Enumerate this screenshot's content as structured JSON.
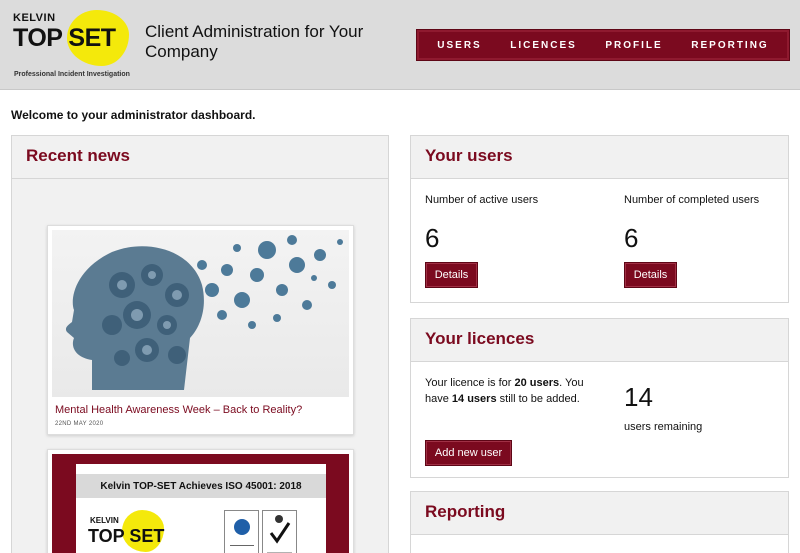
{
  "header": {
    "logo": {
      "kelvin": "KELVIN",
      "wordmark": "TOP SET",
      "tagline": "Professional Incident Investigation"
    },
    "app_title": "Client Administration for Your Company",
    "nav": [
      {
        "label": "USERS"
      },
      {
        "label": "LICENCES"
      },
      {
        "label": "PROFILE"
      },
      {
        "label": "REPORTING"
      }
    ]
  },
  "welcome": "Welcome to your administrator dashboard.",
  "news": {
    "title": "Recent news",
    "items": [
      {
        "title": "Mental Health Awareness Week – Back to Reality?",
        "date": "22ND MAY 2020"
      },
      {
        "banner": "Kelvin TOP-SET Achieves ISO 45001: 2018"
      }
    ]
  },
  "users": {
    "title": "Your users",
    "active_label": "Number of active users",
    "active_value": "6",
    "completed_label": "Number of completed users",
    "completed_value": "6",
    "details_label": "Details"
  },
  "licences": {
    "title": "Your licences",
    "line_pre": "Your licence is for ",
    "total": "20 users",
    "line_mid": ". You have ",
    "remaining_bold": "14 users",
    "line_post": " still to be added.",
    "remaining_value": "14",
    "remaining_label": "users remaining",
    "add_label": "Add new user"
  },
  "reporting": {
    "title": "Reporting"
  },
  "colors": {
    "brand": "#7b0a1f",
    "logo_yellow": "#f4e90b",
    "header_bg": "#dcdcdc"
  }
}
